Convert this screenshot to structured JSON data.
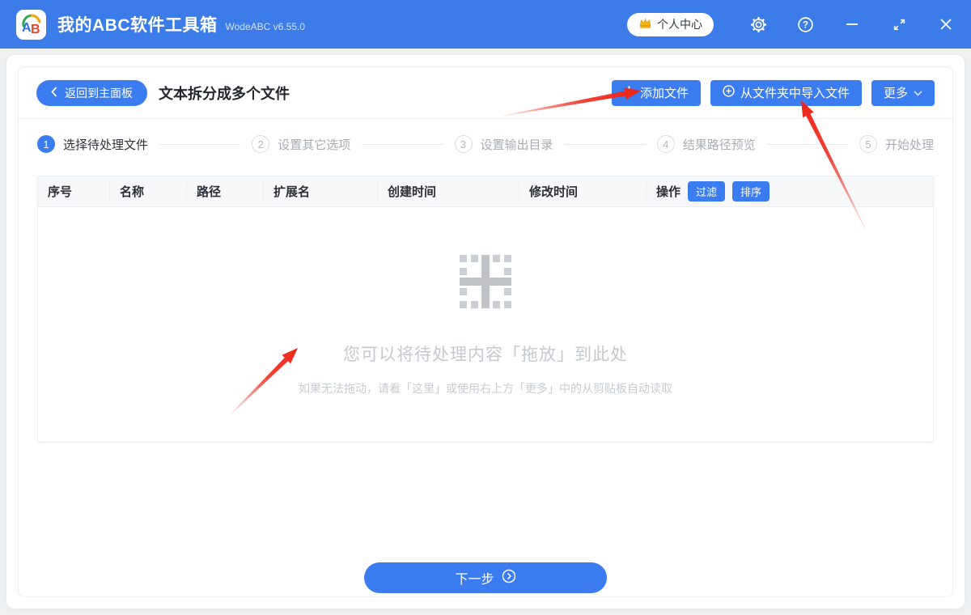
{
  "window": {
    "title": "我的ABC软件工具箱",
    "version": "WodeABC v6.55.0",
    "user_center": "个人中心"
  },
  "toolbar": {
    "back_label": "返回到主面板",
    "page_title": "文本拆分成多个文件",
    "add_files_label": "添加文件",
    "import_from_folder_label": "从文件夹中导入文件",
    "more_label": "更多"
  },
  "steps": [
    {
      "num": "1",
      "label": "选择待处理文件"
    },
    {
      "num": "2",
      "label": "设置其它选项"
    },
    {
      "num": "3",
      "label": "设置输出目录"
    },
    {
      "num": "4",
      "label": "结果路径预览"
    },
    {
      "num": "5",
      "label": "开始处理"
    }
  ],
  "table": {
    "headers": [
      "序号",
      "名称",
      "路径",
      "扩展名",
      "创建时间",
      "修改时间",
      "操作"
    ],
    "filter_label": "过滤",
    "sort_label": "排序",
    "rows": []
  },
  "dropzone": {
    "title": "您可以将待处理内容「拖放」到此处",
    "subtitle": "如果无法拖动，请看「这里」或使用右上方「更多」中的从剪贴板自动读取"
  },
  "footer": {
    "next_label": "下一步"
  },
  "colors": {
    "accent": "#3b7cf0",
    "titlebar": "#3b7ce9",
    "arrow_red": "#f03126"
  }
}
